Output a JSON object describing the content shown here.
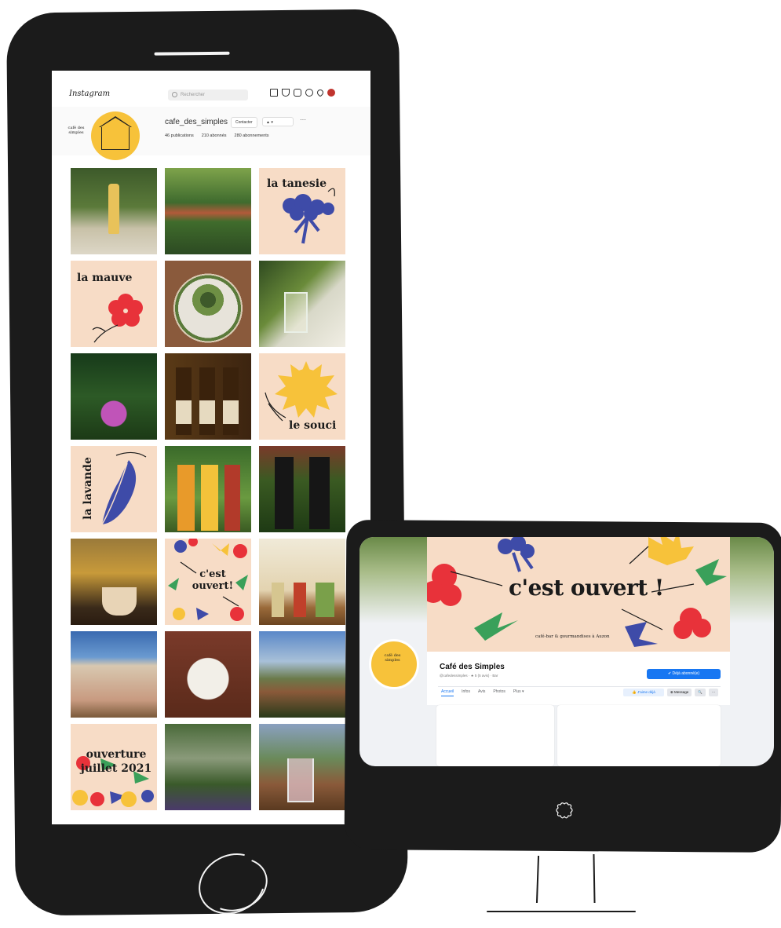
{
  "instagram": {
    "logo": "Instagram",
    "search_placeholder": "Rechercher",
    "nav_icons": [
      "home-icon",
      "filter-icon",
      "new-post-icon",
      "explore-icon",
      "heart-icon",
      "profile-avatar-icon"
    ],
    "profile": {
      "avatar_text": "café des simples",
      "username": "cafe_des_simples",
      "contact_label": "Contacter",
      "follow_label": "▲ ▾",
      "more_label": "···",
      "stats": [
        "46 publications",
        "210 abonnés",
        "280 abonnements"
      ]
    },
    "tiles": [
      {
        "kind": "photo",
        "icon": "bottle"
      },
      {
        "kind": "photo",
        "icon": "village"
      },
      {
        "kind": "illustration",
        "label": "la tanesie",
        "icon": "tansy-flower"
      },
      {
        "kind": "illustration",
        "label": "la mauve",
        "icon": "mallow-flower"
      },
      {
        "kind": "photo",
        "icon": "salad"
      },
      {
        "kind": "photo",
        "icon": "glass"
      },
      {
        "kind": "photo",
        "icon": "butterfly"
      },
      {
        "kind": "photo",
        "icon": "beer-bottles"
      },
      {
        "kind": "illustration",
        "label": "le souci",
        "icon": "marigold-flower"
      },
      {
        "kind": "illustration",
        "label": "la lavande",
        "icon": "lavender-leaf"
      },
      {
        "kind": "photo",
        "icon": "juice-bottles"
      },
      {
        "kind": "photo",
        "icon": "wine-bottles"
      },
      {
        "kind": "photo",
        "icon": "coffee-cup"
      },
      {
        "kind": "illustration",
        "label": "c'est ouvert!",
        "icon": "flowers"
      },
      {
        "kind": "photo",
        "icon": "shelf-bottles"
      },
      {
        "kind": "photo",
        "icon": "building"
      },
      {
        "kind": "photo",
        "icon": "tea-set"
      },
      {
        "kind": "photo",
        "icon": "landscape"
      },
      {
        "kind": "illustration",
        "label": "ouverture juillet 2021",
        "icon": "flowers"
      },
      {
        "kind": "photo",
        "icon": "garden"
      },
      {
        "kind": "photo",
        "icon": "drink"
      }
    ]
  },
  "facebook": {
    "cover_title": "c'est ouvert !",
    "cover_subtitle": "café-bar & gourmandises à Auzon",
    "avatar_text": "café des simples",
    "page_name": "Café des Simples",
    "page_handle": "@cafedessimples · ★ 5 (5 avis) · Bar",
    "subscribe_label": "✔ Déjà abonné(e)",
    "tabs": [
      "Accueil",
      "Infos",
      "Avis",
      "Photos",
      "Plus ▾"
    ],
    "actions": [
      "👍 J'aime déjà",
      "⊕ Message",
      "🔍",
      "···"
    ]
  },
  "colors": {
    "ink": "#1b1b1b",
    "peach": "#f7dcc6",
    "yellow": "#f7c23a",
    "blue": "#3e4ba8",
    "red": "#e8323a",
    "facebook_blue": "#1877f2"
  }
}
